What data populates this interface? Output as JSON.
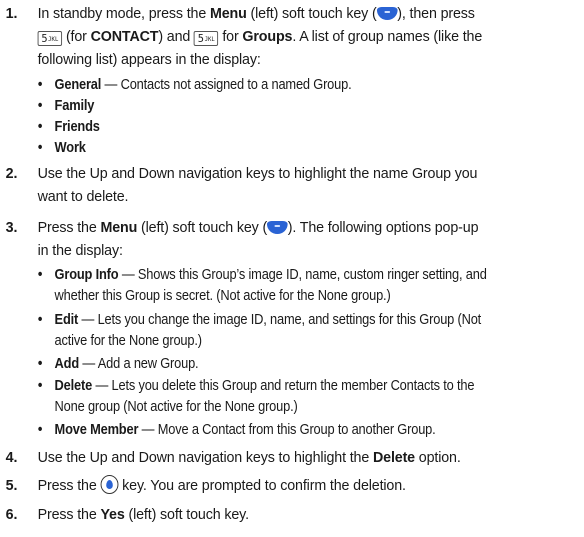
{
  "bullet": "•",
  "steps": [
    {
      "number": "1.",
      "t1": "In standby mode, press the ",
      "t2": "Menu",
      "t3": " (left) soft touch key (",
      "t4": "), then press",
      "key5": "5",
      "key5_sub": "JKL",
      "t5": " (for ",
      "t6": "CONTACT",
      "t7": ") and ",
      "t8": " for ",
      "t9": "Groups",
      "t10": ". A list of group names (like the",
      "line3": "following list) appears in the display:"
    },
    {
      "number": "2.",
      "line1": "Use the Up and Down navigation keys to highlight the name Group you",
      "line2": "want to delete."
    },
    {
      "number": "3.",
      "t1": "Press the ",
      "t2": "Menu",
      "t3": " (left) soft touch key (",
      "t4": "). The following options pop-up",
      "line2": "in the display:"
    },
    {
      "number": "4.",
      "t1": "Use the Up and Down navigation keys to highlight the ",
      "t2": "Delete",
      "t3": " option."
    },
    {
      "number": "5.",
      "t1": "Press the ",
      "t2": " key. You are prompted to confirm the deletion."
    },
    {
      "number": "6.",
      "t1": "Press the ",
      "t2": "Yes",
      "t3": " (left) soft touch key."
    }
  ],
  "groups": [
    {
      "name": "General",
      "desc": " — Contacts not assigned to a named Group."
    },
    {
      "name": "Family"
    },
    {
      "name": "Friends"
    },
    {
      "name": "Work"
    }
  ],
  "options": [
    {
      "name": "Group Info",
      "desc1": " — Shows this Group’s image ID, name, custom ringer setting, and",
      "desc2": "whether this Group is secret. (Not active for the None group.)"
    },
    {
      "name": "Edit",
      "desc1": " — Lets you change the image ID, name, and settings for this Group (Not",
      "desc2": "active for the None group.)"
    },
    {
      "name": "Add",
      "desc1": " — Add a new Group."
    },
    {
      "name": "Delete",
      "desc1": " — Lets you delete this Group and return the member Contacts to the",
      "desc2": "None group (Not active for the None group.)"
    },
    {
      "name": "Move Member",
      "desc1": " — Move a Contact from this Group to another Group."
    }
  ]
}
